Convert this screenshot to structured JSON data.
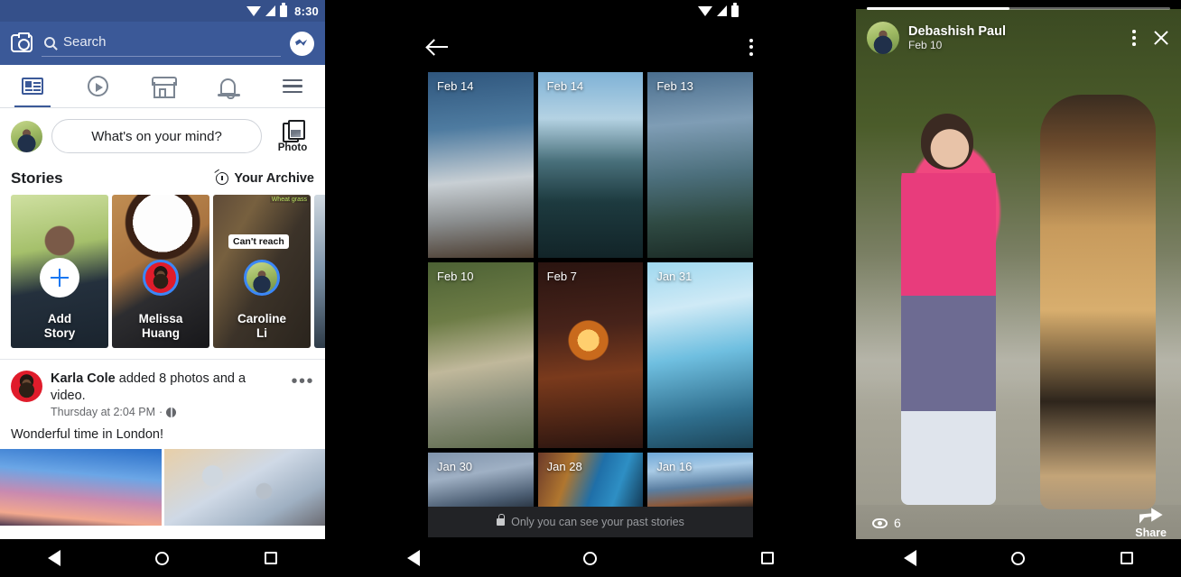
{
  "feed": {
    "statusbar": {
      "time": "8:30",
      "wifi_icon": "wifi-icon",
      "signal_icon": "signal-icon",
      "battery_icon": "battery-icon"
    },
    "header": {
      "camera_icon": "camera-icon",
      "search_placeholder": "Search",
      "messenger_icon": "messenger-icon"
    },
    "tabs": [
      {
        "name": "news-feed",
        "icon": "news-feed-icon",
        "active": true
      },
      {
        "name": "watch",
        "icon": "video-play-icon",
        "active": false
      },
      {
        "name": "marketplace",
        "icon": "storefront-icon",
        "active": false
      },
      {
        "name": "notifications",
        "icon": "bell-icon",
        "active": false
      },
      {
        "name": "menu",
        "icon": "hamburger-menu-icon",
        "active": false
      }
    ],
    "composer": {
      "placeholder": "What's on your mind?",
      "photo_label": "Photo",
      "photo_icon": "photo-icon"
    },
    "stories": {
      "title": "Stories",
      "archive_label": "Your Archive",
      "archive_icon": "clock-history-icon",
      "cards": [
        {
          "label": "Add\nStory",
          "label_line1": "Add",
          "label_line2": "Story",
          "type": "add"
        },
        {
          "label_line1": "Melissa",
          "label_line2": "Huang",
          "type": "story"
        },
        {
          "label_line1": "Caroline",
          "label_line2": "Li",
          "type": "story",
          "overlay_text": "Can't reach",
          "corner_text": "Wheat grass"
        },
        {
          "label_line1": "",
          "label_line2": "",
          "type": "peek"
        }
      ]
    },
    "post": {
      "author": "Karla Cole",
      "action": " added 8 photos and a video.",
      "timestamp": "Thursday at 2:04 PM",
      "privacy_icon": "globe-icon",
      "menu_icon": "more-options-icon",
      "body": "Wonderful time in London!"
    }
  },
  "archive": {
    "statusbar": {
      "wifi_icon": "wifi-icon",
      "signal_icon": "signal-icon",
      "battery_icon": "battery-icon"
    },
    "toolbar": {
      "back_icon": "back-arrow-icon",
      "menu_icon": "more-options-icon"
    },
    "grid": [
      {
        "date": "Feb 14"
      },
      {
        "date": "Feb 14"
      },
      {
        "date": "Feb 13"
      },
      {
        "date": "Feb 10"
      },
      {
        "date": "Feb 7"
      },
      {
        "date": "Jan 31"
      },
      {
        "date": "Jan 30"
      },
      {
        "date": "Jan 28"
      },
      {
        "date": "Jan 16"
      }
    ],
    "footer": {
      "lock_icon": "lock-icon",
      "text": "Only you can see your past stories"
    }
  },
  "viewer": {
    "progress_percent": 47,
    "author": "Debashish Paul",
    "date": "Feb 10",
    "menu_icon": "more-options-icon",
    "close_icon": "close-icon",
    "views_icon": "eye-icon",
    "views_count": "6",
    "share_icon": "share-arrow-icon",
    "share_label": "Share"
  },
  "navbar": {
    "back_icon": "nav-back-icon",
    "home_icon": "nav-home-icon",
    "recents_icon": "nav-recents-icon"
  },
  "colors": {
    "fb_blue": "#3b5998",
    "fb_statusbar": "#35508a",
    "accent_blue": "#1877f2",
    "story_ring": "#3b87f7"
  }
}
